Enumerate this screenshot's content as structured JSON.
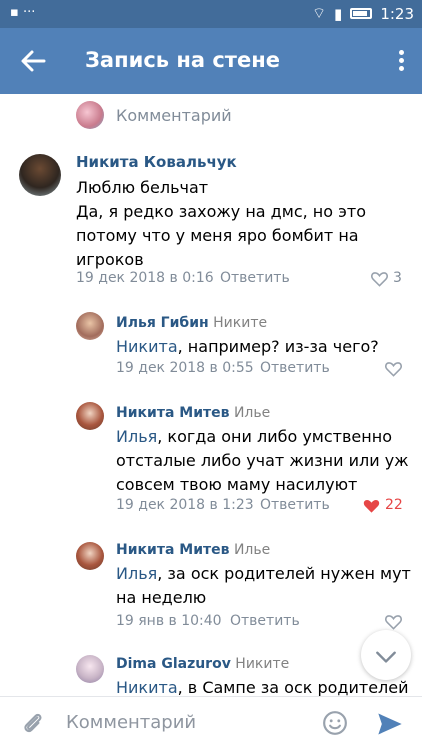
{
  "statusbar": {
    "time": "1:23"
  },
  "header": {
    "title": "Запись на стене"
  },
  "top_composer": {
    "label": "Комментарий"
  },
  "comments": [
    {
      "author": "Никита Ковальчук",
      "reply_to": "",
      "text": [
        "Люблю бельчат",
        "Да, я редко захожу на дмс, но это",
        "потому что у меня яро бомбит на",
        "игроков"
      ],
      "date": "19 дек 2018 в 0:16",
      "reply_label": "Ответить",
      "likes": "3",
      "liked": false
    },
    {
      "author": "Илья Гибин",
      "reply_to": "Никите",
      "mention": "Никита",
      "text": [
        ", например? из-за чего?"
      ],
      "date": "19 дек 2018 в 0:55",
      "reply_label": "Ответить",
      "likes": "",
      "liked": false
    },
    {
      "author": "Никита Митев",
      "reply_to": "Илье",
      "mention": "Илья",
      "text": [
        ", когда они либо умственно",
        "отсталые либо учат жизни или уж",
        "совсем твою маму насилуют"
      ],
      "date": "19 дек 2018 в 1:23",
      "reply_label": "Ответить",
      "likes": "22",
      "liked": true
    },
    {
      "author": "Никита Митев",
      "reply_to": "Илье",
      "mention": "Илья",
      "text": [
        ", за оск родителей нужен мут",
        "на неделю"
      ],
      "date": "19 янв в 10:40",
      "reply_label": "Ответить",
      "likes": "",
      "liked": false
    },
    {
      "author": "Dima Glazurov",
      "reply_to": "Никите",
      "mention": "Никита",
      "text": [
        ", в Сампе за оск родителей"
      ],
      "date": "",
      "reply_label": "",
      "likes": "",
      "liked": false
    }
  ],
  "composer": {
    "placeholder": "Комментарий"
  },
  "colors": {
    "header": "#5181b8",
    "statusbar": "#426c9a",
    "name": "#2a5885",
    "meta": "#818c99",
    "like_active": "#e64646"
  },
  "icons": [
    "back-arrow-icon",
    "more-vertical-icon",
    "heart-icon",
    "paperclip-icon",
    "smile-icon",
    "send-icon",
    "chevron-down-icon"
  ]
}
